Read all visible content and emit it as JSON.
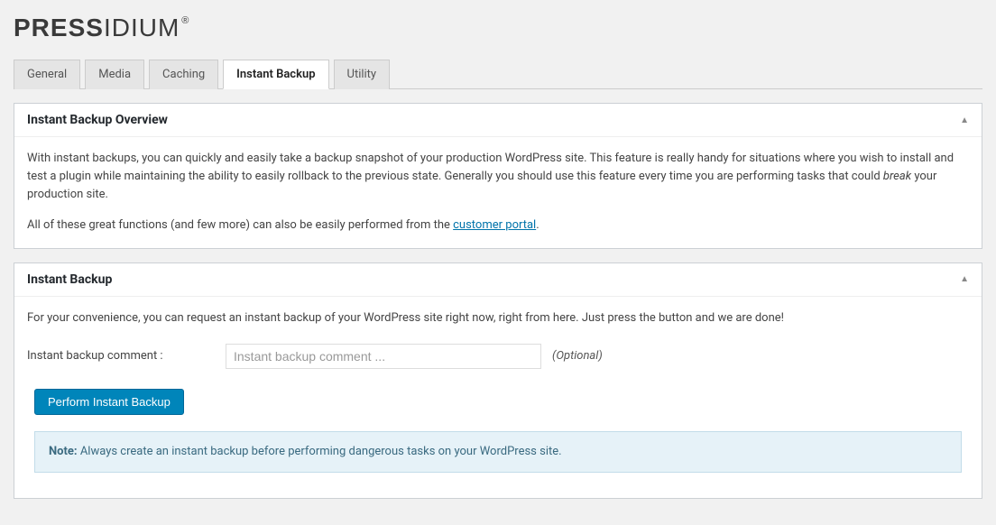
{
  "logo": {
    "bold": "PRESS",
    "light": "IDIUM",
    "reg": "®"
  },
  "tabs": [
    {
      "label": "General"
    },
    {
      "label": "Media"
    },
    {
      "label": "Caching"
    },
    {
      "label": "Instant Backup",
      "active": true
    },
    {
      "label": "Utility"
    }
  ],
  "overview": {
    "title": "Instant Backup Overview",
    "p1a": "With instant backups, you can quickly and easily take a backup snapshot of your production WordPress site. This feature is really handy for situations where you wish to install and test a plugin while maintaining the ability to easily rollback to the previous state. Generally you should use this feature every time you are performing tasks that could ",
    "em": "break",
    "p1b": " your production site.",
    "p2a": "All of these great functions (and few more) can also be easily performed from the ",
    "link": "customer portal",
    "p2b": "."
  },
  "backup": {
    "title": "Instant Backup",
    "intro": "For your convenience, you can request an instant backup of your WordPress site right now, right from here. Just press the button and we are done!",
    "comment_label": "Instant backup comment :",
    "comment_placeholder": "Instant backup comment ...",
    "optional": "(Optional)",
    "button": "Perform Instant Backup",
    "note_label": "Note:",
    "note_text": " Always create an instant backup before performing dangerous tasks on your WordPress site."
  }
}
